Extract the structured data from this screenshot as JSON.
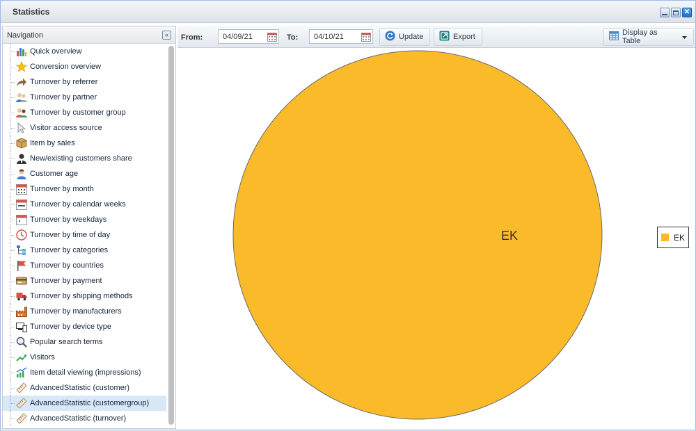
{
  "window": {
    "title": "Statistics"
  },
  "navigation": {
    "title": "Navigation",
    "items": [
      {
        "label": "Quick overview",
        "icon": "bar-chart-icon"
      },
      {
        "label": "Conversion overview",
        "icon": "star-icon"
      },
      {
        "label": "Turnover by referrer",
        "icon": "arrow-share-icon"
      },
      {
        "label": "Turnover by partner",
        "icon": "partner-users-icon"
      },
      {
        "label": "Turnover by customer group",
        "icon": "customer-group-icon"
      },
      {
        "label": "Visitor access source",
        "icon": "cursor-icon"
      },
      {
        "label": "Item by sales",
        "icon": "package-icon"
      },
      {
        "label": "New/existing customers share",
        "icon": "customer-silhouette-icon"
      },
      {
        "label": "Customer age",
        "icon": "user-icon"
      },
      {
        "label": "Turnover by month",
        "icon": "calendar-month-icon"
      },
      {
        "label": "Turnover by calendar weeks",
        "icon": "calendar-weeks-icon"
      },
      {
        "label": "Turnover by weekdays",
        "icon": "calendar-weekdays-icon"
      },
      {
        "label": "Turnover by time of day",
        "icon": "clock-icon"
      },
      {
        "label": "Turnover by categories",
        "icon": "category-tree-icon"
      },
      {
        "label": "Turnover by countries",
        "icon": "flag-icon"
      },
      {
        "label": "Turnover by payment",
        "icon": "credit-card-icon"
      },
      {
        "label": "Turnover by shipping methods",
        "icon": "truck-icon"
      },
      {
        "label": "Turnover by manufacturers",
        "icon": "factory-icon"
      },
      {
        "label": "Turnover by device type",
        "icon": "devices-icon"
      },
      {
        "label": "Popular search terms",
        "icon": "magnifier-icon"
      },
      {
        "label": "Visitors",
        "icon": "trend-up-icon"
      },
      {
        "label": "Item detail viewing (impressions)",
        "icon": "impressions-chart-icon"
      },
      {
        "label": "AdvancedStatistic (customer)",
        "icon": "ruler-icon"
      },
      {
        "label": "AdvancedStatistic (customergroup)",
        "icon": "ruler-icon"
      },
      {
        "label": "AdvancedStatistic (turnover)",
        "icon": "ruler-icon"
      }
    ],
    "selected_index": 23
  },
  "toolbar": {
    "from_label": "From:",
    "from_value": "04/09/21",
    "to_label": "To:",
    "to_value": "04/10/21",
    "update_label": "Update",
    "export_label": "Export",
    "display_label": "Display as Table"
  },
  "colors": {
    "accent": "#fbba2a"
  },
  "chart_data": {
    "type": "pie",
    "slices": [
      {
        "label": "EK",
        "value": 100,
        "color": "#fbba2a"
      }
    ],
    "legend": [
      "EK"
    ],
    "legend_position": "right"
  }
}
